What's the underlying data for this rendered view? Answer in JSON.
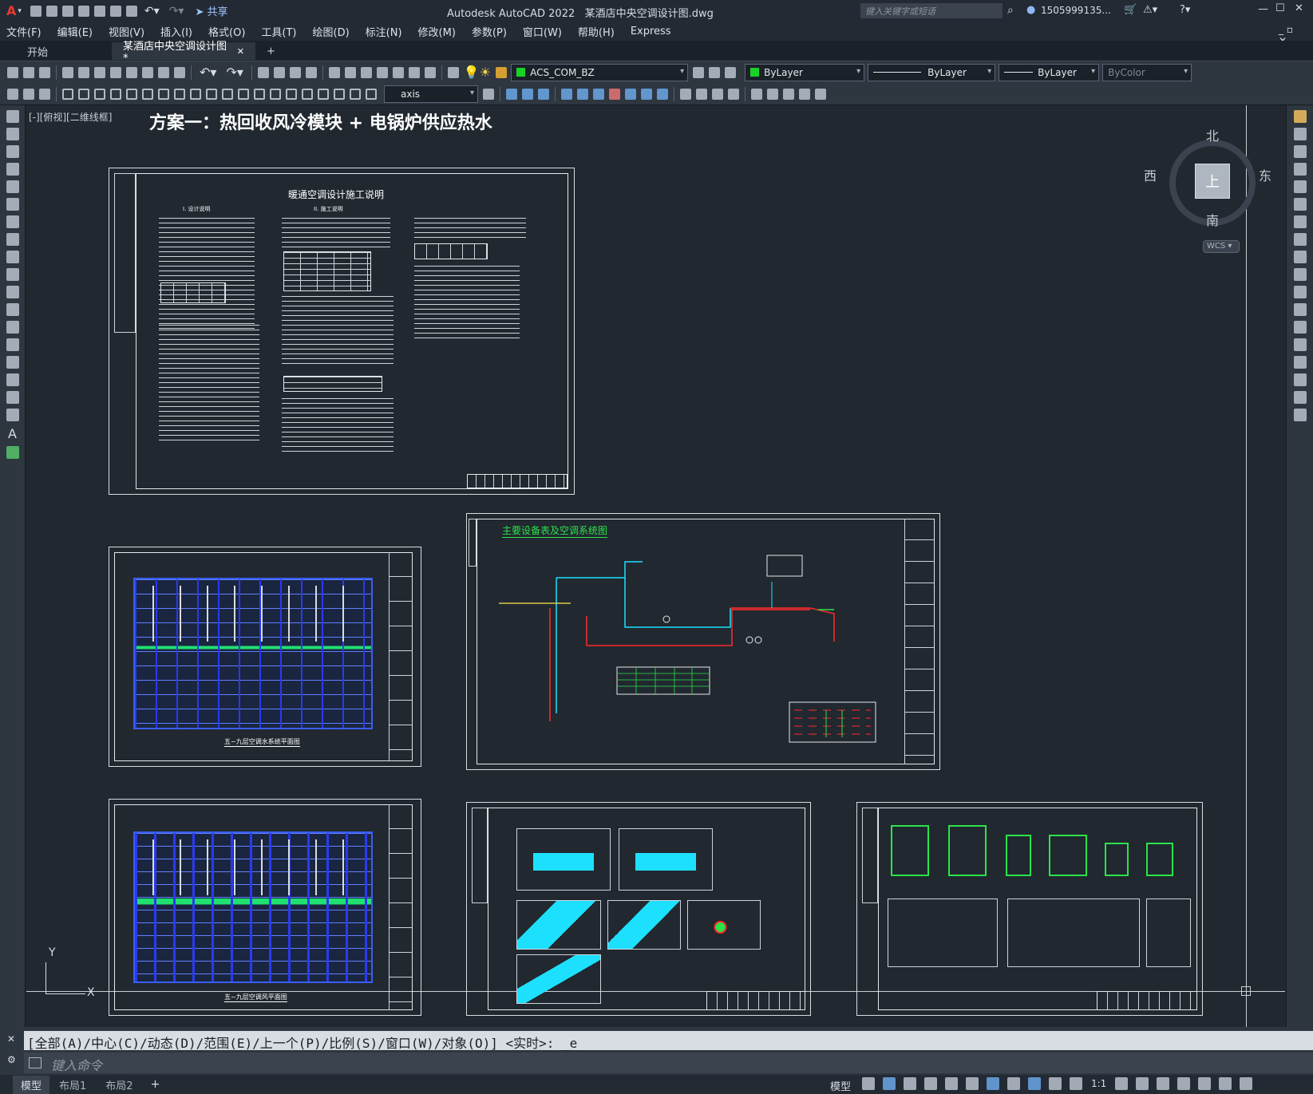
{
  "title": {
    "app": "Autodesk AutoCAD 2022",
    "file": "某酒店中央空调设计图.dwg",
    "search_placeholder": "键入关键字或短语",
    "user": "1505999135...",
    "share": "共享"
  },
  "menu": [
    "文件(F)",
    "编辑(E)",
    "视图(V)",
    "插入(I)",
    "格式(O)",
    "工具(T)",
    "绘图(D)",
    "标注(N)",
    "修改(M)",
    "参数(P)",
    "窗口(W)",
    "帮助(H)",
    "Express"
  ],
  "tabs": {
    "start": "开始",
    "drawing": "某酒店中央空调设计图*",
    "add": "+"
  },
  "toolbar": {
    "layer": "ACS_COM_BZ",
    "color": "ByLayer",
    "linetype": "ByLayer",
    "lineweight": "ByLayer",
    "plotstyle": "ByColor",
    "dimstyle": "axis"
  },
  "viewport_label": "[-][俯视][二维线框]",
  "heading": "方案一：热回收风冷模块 + 电锅炉供应热水",
  "sheets": {
    "notes_title": "暖通空调设计施工说明",
    "notes_sub1": "I. 设计说明",
    "notes_sub2": "II. 施工说明",
    "system_title": "主要设备表及空调系统图",
    "plan1_caption": "五~九层空调水系统平面图",
    "plan2_caption": "五~九层空调风平面图"
  },
  "compass": {
    "n": "北",
    "s": "南",
    "e": "东",
    "w": "西",
    "top": "上",
    "wcs": "WCS"
  },
  "ucs": {
    "y": "Y",
    "x": "X"
  },
  "command": {
    "history": "[全部(A)/中心(C)/动态(D)/范围(E)/上一个(P)/比例(S)/窗口(W)/对象(O)] <实时>: _e",
    "placeholder": "键入命令"
  },
  "layout_tabs": [
    "模型",
    "布局1",
    "布局2"
  ],
  "status": {
    "model": "模型",
    "scale": "1:1"
  }
}
